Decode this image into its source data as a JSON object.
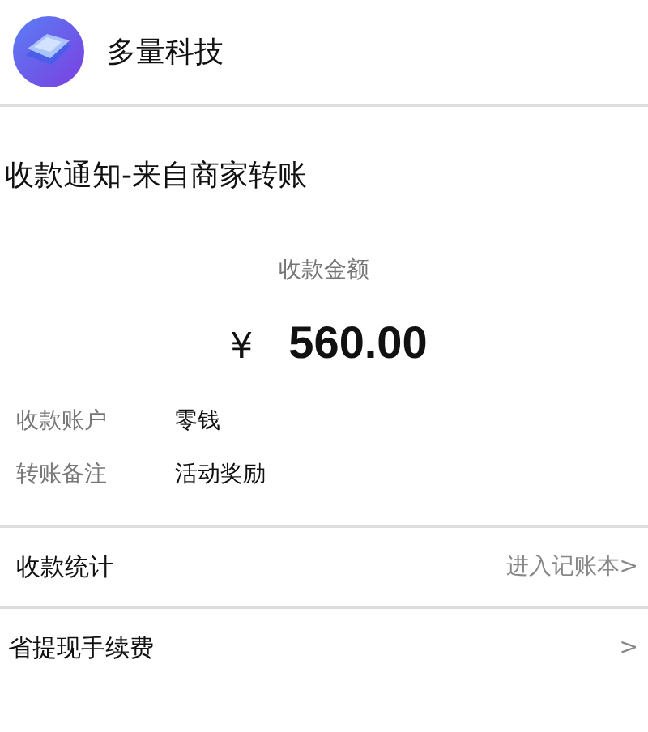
{
  "header": {
    "name": "多量科技"
  },
  "title": "收款通知-来自商家转账",
  "amount_label": "收款金额",
  "currency": "¥",
  "amount": "560.00",
  "details": [
    {
      "label": "收款账户",
      "value": "零钱"
    },
    {
      "label": "转账备注",
      "value": "活动奖励"
    }
  ],
  "links": [
    {
      "label": "收款统计",
      "action": "进入记账本>"
    },
    {
      "label": "省提现手续费",
      "action": ">"
    }
  ]
}
